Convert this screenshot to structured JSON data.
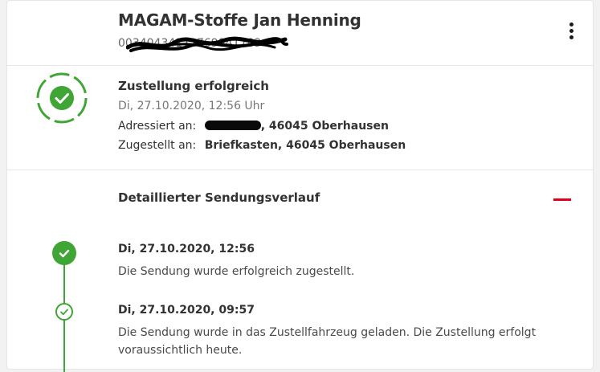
{
  "shipment": {
    "sender_name": "MAGAM-Stoffe Jan Henning",
    "tracking_number": "00340434172769841783"
  },
  "status": {
    "title": "Zustellung erfolgreich",
    "date": "Di, 27.10.2020, 12:56 Uhr",
    "addressed_label": "Adressiert an:",
    "addressed_value": ", 46045 Oberhausen",
    "delivered_label": "Zugestellt an:",
    "delivered_value": "Briefkasten, 46045 Oberhausen",
    "icon": "check-circle-icon"
  },
  "history": {
    "title": "Detaillierter Sendungsverlauf",
    "toggle_icon": "minus-icon",
    "events": [
      {
        "date": "Di, 27.10.2020, 12:56",
        "text": "Die Sendung wurde erfolgreich zugestellt."
      },
      {
        "date": "Di, 27.10.2020, 09:57",
        "text": "Die Sendung wurde in das Zustellfahrzeug geladen. Die Zustellung erfolgt voraussichtlich heute."
      }
    ]
  },
  "colors": {
    "success_green": "#3fa535",
    "accent_red": "#e2001a",
    "text_dark": "#323232",
    "text_muted": "#777777"
  }
}
